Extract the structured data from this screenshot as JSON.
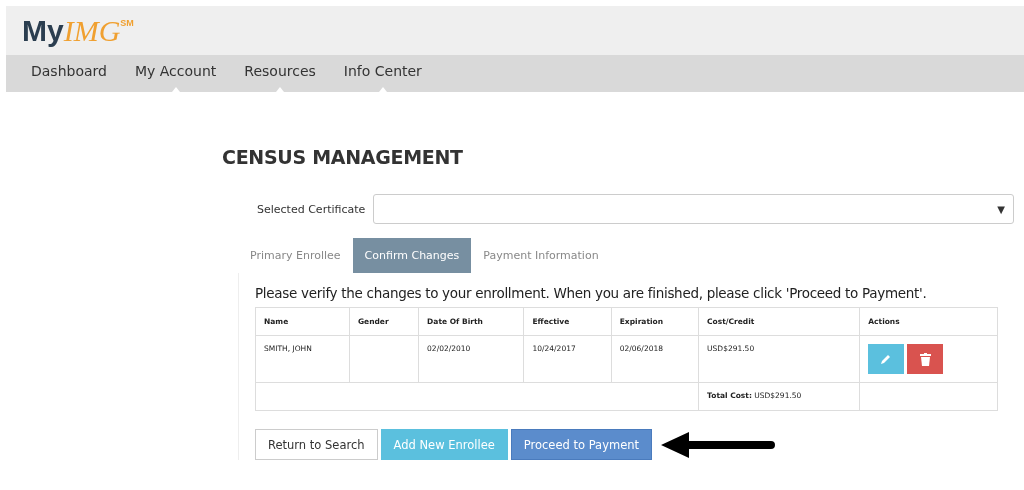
{
  "logo": {
    "first": "My",
    "second": "IMG",
    "mark": "SM"
  },
  "nav": [
    {
      "label": "Dashboard",
      "marker": false
    },
    {
      "label": "My Account",
      "marker": true
    },
    {
      "label": "Resources",
      "marker": true
    },
    {
      "label": "Info Center",
      "marker": true
    }
  ],
  "page_title": "CENSUS MANAGEMENT",
  "certificate": {
    "label": "Selected Certificate",
    "caret": "▼"
  },
  "tabs": [
    {
      "label": "Primary Enrollee",
      "selected": false
    },
    {
      "label": "Confirm Changes",
      "selected": true
    },
    {
      "label": "Payment Information",
      "selected": false
    }
  ],
  "instructions": "Please verify the changes to your enrollment. When you are finished, please click 'Proceed to Payment'.",
  "table": {
    "columns": [
      "Name",
      "Gender",
      "Date Of Birth",
      "Effective",
      "Expiration",
      "Cost/Credit",
      "Actions"
    ],
    "rows": [
      [
        "SMITH, JOHN",
        "",
        "02/02/2010",
        "10/24/2017",
        "02/06/2018",
        "USD$291.50"
      ]
    ],
    "total": "**Total Cost:** USD$291.50"
  },
  "buttons": [
    {
      "label": "Return to Search",
      "kind": "plain"
    },
    {
      "label": "Add New Enrollee",
      "kind": "info"
    },
    {
      "label": "Proceed to Payment",
      "kind": "primary"
    }
  ]
}
